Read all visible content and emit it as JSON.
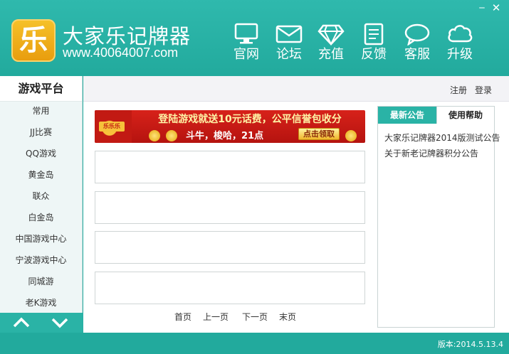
{
  "window": {
    "minimize_icon": "minimize-icon",
    "close_icon": "close-icon"
  },
  "brand": {
    "logo_char": "乐",
    "name": "大家乐记牌器",
    "url": "www.40064007.com",
    "logo_color": "#f2b11f"
  },
  "nav": [
    {
      "label": "官网",
      "icon": "monitor-icon"
    },
    {
      "label": "论坛",
      "icon": "envelope-icon"
    },
    {
      "label": "充值",
      "icon": "diamond-icon"
    },
    {
      "label": "反馈",
      "icon": "document-icon"
    },
    {
      "label": "客服",
      "icon": "chat-bubble-icon"
    },
    {
      "label": "升级",
      "icon": "cloud-icon"
    }
  ],
  "sidebar": {
    "title": "游戏平台",
    "items": [
      {
        "label": "常用"
      },
      {
        "label": "JJ比赛"
      },
      {
        "label": "QQ游戏"
      },
      {
        "label": "黄金岛"
      },
      {
        "label": "联众"
      },
      {
        "label": "白金岛"
      },
      {
        "label": "中国游戏中心"
      },
      {
        "label": "宁波游戏中心"
      },
      {
        "label": "同城游"
      },
      {
        "label": "老K游戏"
      }
    ]
  },
  "topbar": {
    "register": "注册",
    "login": "登录"
  },
  "banner": {
    "badge": "乐乐乐",
    "main": "登陆游戏就送10元话费，公平信誉包收分",
    "sub": "斗牛，梭哈，21点",
    "button": "点击领取"
  },
  "pager": {
    "first": "首页",
    "prev": "上一页",
    "next": "下一页",
    "last": "末页"
  },
  "notice": {
    "tab_news": "最新公告",
    "tab_help": "使用帮助",
    "items": [
      {
        "text": "大家乐记牌器2014版测试公告"
      },
      {
        "text": "关于新老记牌器积分公告"
      }
    ]
  },
  "footer": {
    "version": "版本:2014.5.13.4"
  },
  "colors": {
    "accent": "#2ab3a6",
    "banner_red": "#c21a13"
  }
}
